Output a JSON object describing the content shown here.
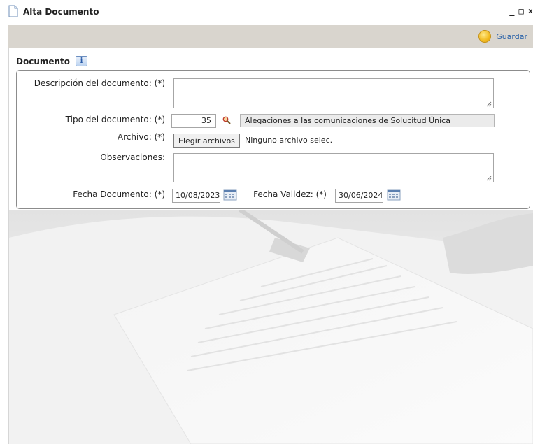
{
  "window": {
    "title": "Alta Documento",
    "controls": [
      "_",
      "□",
      "×"
    ]
  },
  "toolbar": {
    "save_label": "Guardar"
  },
  "section": {
    "title": "Documento",
    "info_icon": "info-icon"
  },
  "form": {
    "descripcion": {
      "label": "Descripción del documento: (*)",
      "value": ""
    },
    "tipo": {
      "label": "Tipo del documento: (*)",
      "code": "35",
      "description": "Alegaciones a las comunicaciones de Solucitud Única"
    },
    "archivo": {
      "label": "Archivo: (*)",
      "button": "Elegir archivos",
      "status": "Ninguno archivo selec."
    },
    "observaciones": {
      "label": "Observaciones:",
      "value": ""
    },
    "fecha_documento": {
      "label": "Fecha Documento: (*)",
      "value": "10/08/2023"
    },
    "fecha_validez": {
      "label": "Fecha Validez: (*)",
      "value": "30/06/2024"
    }
  },
  "colors": {
    "toolbar_bg": "#d9d5ce",
    "accent_link": "#2a62a8",
    "save_icon": "#f2b91c"
  }
}
